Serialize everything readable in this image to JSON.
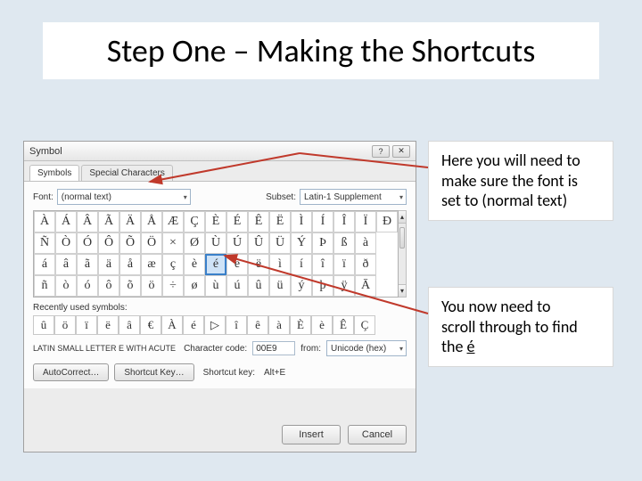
{
  "title": "Step One – Making the Shortcuts",
  "callout1_l1": "Here you will need to",
  "callout1_l2": "make sure the font is",
  "callout1_l3": "set to (normal text)",
  "callout2_l1": "You now need to",
  "callout2_l2": "scroll through to find",
  "callout2_l3": "the ",
  "callout2_char": "é",
  "dialog": {
    "title": "Symbol",
    "tabs": {
      "symbols": "Symbols",
      "special": "Special Characters"
    },
    "font_label": "Font:",
    "font_value": "(normal text)",
    "subset_label": "Subset:",
    "subset_value": "Latin-1 Supplement",
    "grid": [
      [
        "À",
        "Á",
        "Â",
        "Ã",
        "Ä",
        "Å",
        "Æ",
        "Ç",
        "È",
        "É",
        "Ê",
        "Ë",
        "Ì",
        "Í",
        "Î",
        "Ï",
        "Ð"
      ],
      [
        "Ñ",
        "Ò",
        "Ó",
        "Ô",
        "Õ",
        "Ö",
        "×",
        "Ø",
        "Ù",
        "Ú",
        "Û",
        "Ü",
        "Ý",
        "Þ",
        "ß",
        "à"
      ],
      [
        "á",
        "â",
        "ã",
        "ä",
        "å",
        "æ",
        "ç",
        "è",
        "é",
        "ê",
        "ë",
        "ì",
        "í",
        "î",
        "ï",
        "ð"
      ],
      [
        "ñ",
        "ò",
        "ó",
        "ô",
        "õ",
        "ö",
        "÷",
        "ø",
        "ù",
        "ú",
        "û",
        "ü",
        "ý",
        "þ",
        "ÿ",
        "Ā"
      ]
    ],
    "selected_char": "é",
    "recent_label": "Recently used symbols:",
    "recent": [
      "û",
      "ö",
      "ï",
      "ë",
      "â",
      "€",
      "À",
      "é",
      "▷",
      "î",
      "ê",
      "à",
      "È",
      "è",
      "Ê",
      "Ç"
    ],
    "unicode_name": "LATIN SMALL LETTER E WITH ACUTE",
    "code_label": "Character code:",
    "code_value": "00E9",
    "from_label": "from:",
    "from_value": "Unicode (hex)",
    "autocorrect": "AutoCorrect…",
    "shortcut_key": "Shortcut Key…",
    "shortcut_label": "Shortcut key:",
    "shortcut_value": "Alt+E",
    "insert": "Insert",
    "cancel": "Cancel"
  }
}
